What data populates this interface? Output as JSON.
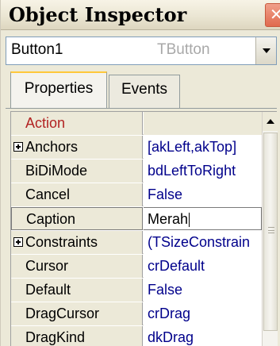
{
  "window": {
    "title": "Object Inspector",
    "close_glyph": "✕"
  },
  "selector": {
    "component_name": "Button1",
    "component_type": "TButton"
  },
  "tabs": [
    {
      "label": "Properties",
      "active": true
    },
    {
      "label": "Events",
      "active": false
    }
  ],
  "properties": [
    {
      "name": "Action",
      "value": "",
      "expandable": false,
      "highlight": true
    },
    {
      "name": "Anchors",
      "value": "[akLeft,akTop]",
      "expandable": true
    },
    {
      "name": "BiDiMode",
      "value": "bdLeftToRight",
      "expandable": false
    },
    {
      "name": "Cancel",
      "value": "False",
      "expandable": false
    },
    {
      "name": "Caption",
      "value": "Merah",
      "expandable": false,
      "editing": true
    },
    {
      "name": "Constraints",
      "value": "(TSizeConstrain",
      "expandable": true
    },
    {
      "name": "Cursor",
      "value": "crDefault",
      "expandable": false
    },
    {
      "name": "Default",
      "value": "False",
      "expandable": false
    },
    {
      "name": "DragCursor",
      "value": "crDrag",
      "expandable": false
    },
    {
      "name": "DragKind",
      "value": "dkDrag",
      "expandable": false
    }
  ],
  "colors": {
    "value_text": "#00008b",
    "highlight_name": "#b22222",
    "active_tab_accent": "#ffc83c"
  },
  "icons": {
    "close": "close-icon",
    "combo_arrow": "chevron-down-icon",
    "expander": "plus-box-icon",
    "scroll_up": "arrow-up-icon"
  }
}
